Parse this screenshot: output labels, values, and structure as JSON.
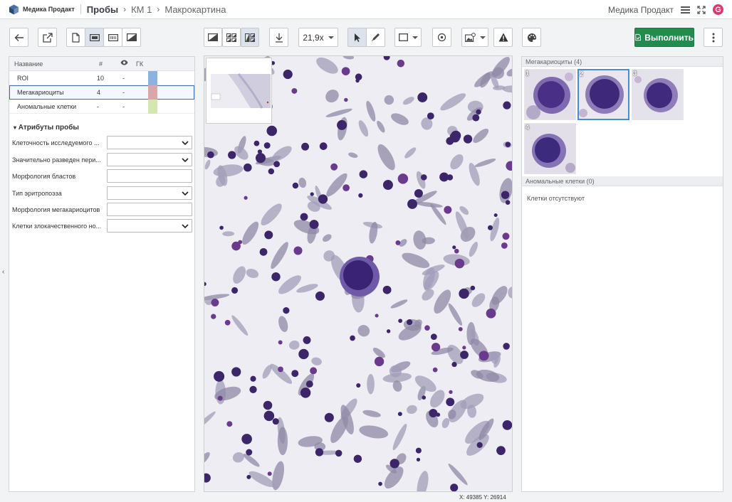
{
  "header": {
    "logo_text": "Медика Продакт",
    "breadcrumb": [
      "Пробы",
      "КМ 1",
      "Макрокартина"
    ],
    "org_name": "Медика Продакт",
    "user_initial": "G",
    "user_color": "#e0366f"
  },
  "toolbar": {
    "zoom": "21,9x",
    "run_label": "Выполнить",
    "icons": [
      "back-arrow-icon",
      "external-link-icon",
      "page-icon",
      "slide-label-icon",
      "barcode-slide-icon",
      "slide-contrast-icon",
      "single-view-icon",
      "grid-view-icon",
      "split-view-icon",
      "download-icon",
      "pointer-icon",
      "pencil-icon",
      "rectangle-icon",
      "target-icon",
      "image-settings-icon",
      "warning-icon",
      "palette-icon",
      "kebab-menu-icon"
    ]
  },
  "table": {
    "headers": {
      "name": "Название",
      "count": "#",
      "gk": "ГК"
    },
    "rows": [
      {
        "name": "ROI",
        "count": "10",
        "visible": "-",
        "color": "#8cb3e0"
      },
      {
        "name": "Мегакариоциты",
        "count": "4",
        "visible": "-",
        "color": "#d9a6ab"
      },
      {
        "name": "Аномальные клетки",
        "count": "-",
        "visible": "-",
        "color": "#d5e6b3"
      }
    ]
  },
  "attributes": {
    "title": "Атрибуты пробы",
    "fields": [
      {
        "label": "Клеточность исследуемого ...",
        "type": "select",
        "value": ""
      },
      {
        "label": "Значительно разведен пери...",
        "type": "select",
        "value": ""
      },
      {
        "label": "Морфология бластов",
        "type": "text",
        "value": ""
      },
      {
        "label": "Тип эритропоэза",
        "type": "select",
        "value": ""
      },
      {
        "label": "Морфология мегакариоцитов",
        "type": "text",
        "value": ""
      },
      {
        "label": "Клетки злокачественного но...",
        "type": "select",
        "value": ""
      }
    ]
  },
  "viewer": {
    "coords": "X: 49385  Y: 26914"
  },
  "right_panel": {
    "megakaryocytes_title": "Мегакариоциты (4)",
    "thumbnails": [
      "1",
      "2",
      "3",
      "4"
    ],
    "selected_thumbnail": "2",
    "anomalous_title": "Аномальные клетки (0)",
    "anomalous_empty": "Клетки отсутствуют"
  },
  "colors": {
    "accent": "#3d6fb8",
    "run_button": "#228b4e",
    "cell_stain": "#4a2f86",
    "stroma": "#8f88a6"
  }
}
